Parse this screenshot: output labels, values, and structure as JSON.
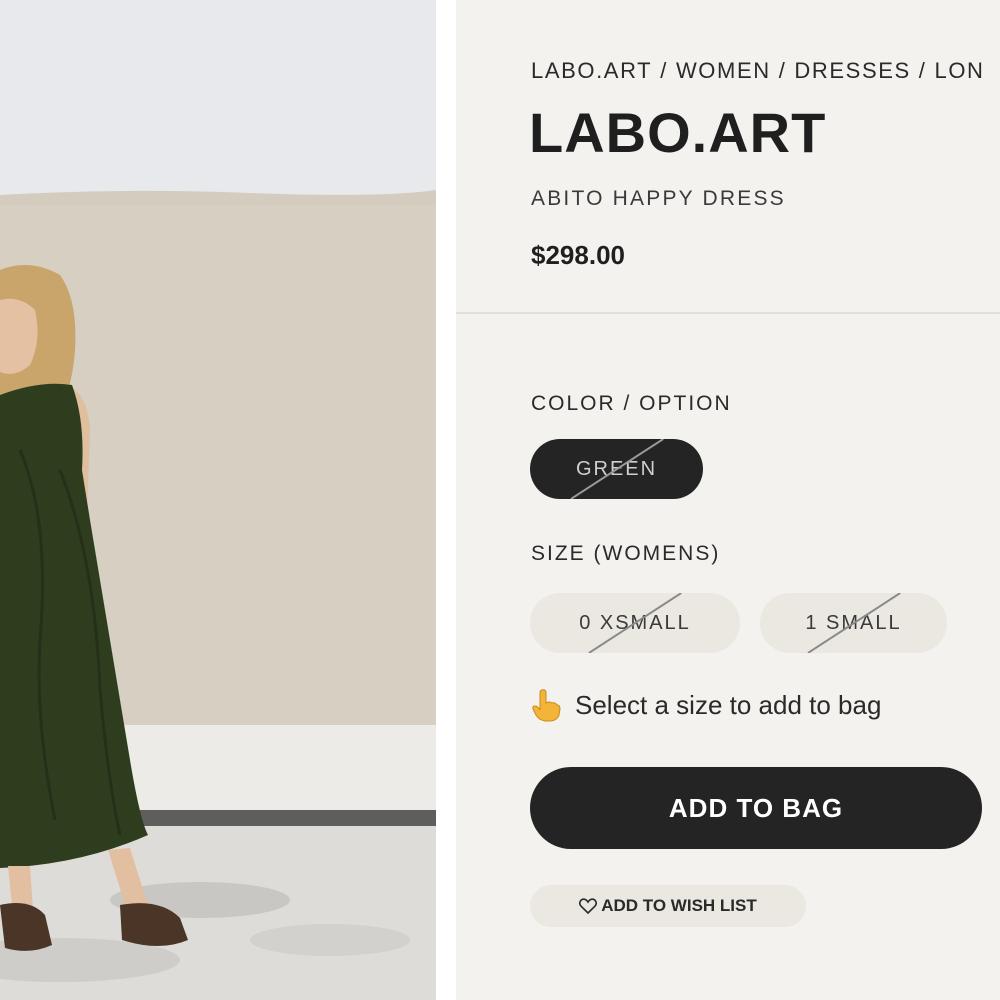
{
  "breadcrumb": [
    "LABO.ART",
    "WOMEN",
    "DRESSES",
    "LON"
  ],
  "brand": "LABO.ART",
  "product_name": "ABITO HAPPY DRESS",
  "price": "$298.00",
  "color_section": {
    "label": "COLOR / OPTION",
    "options": [
      {
        "label": "GREEN",
        "selected": true,
        "unavailable": true
      }
    ]
  },
  "size_section": {
    "label": "SIZE (WOMENS)",
    "options": [
      {
        "label": "0 XSMALL",
        "unavailable": true
      },
      {
        "label": "1 SMALL",
        "unavailable": true
      }
    ]
  },
  "hint": {
    "icon": "pointing-hand-icon",
    "text": "Select a size to add to bag"
  },
  "add_to_bag": "ADD TO BAG",
  "wish_list": {
    "icon": "heart-icon",
    "label": "ADD TO WISH LIST"
  },
  "colors": {
    "dark": "#242424",
    "panel_bg": "#f4f2ef",
    "pill_bg": "#ebe7e1",
    "dress": "#2f3d1f"
  }
}
